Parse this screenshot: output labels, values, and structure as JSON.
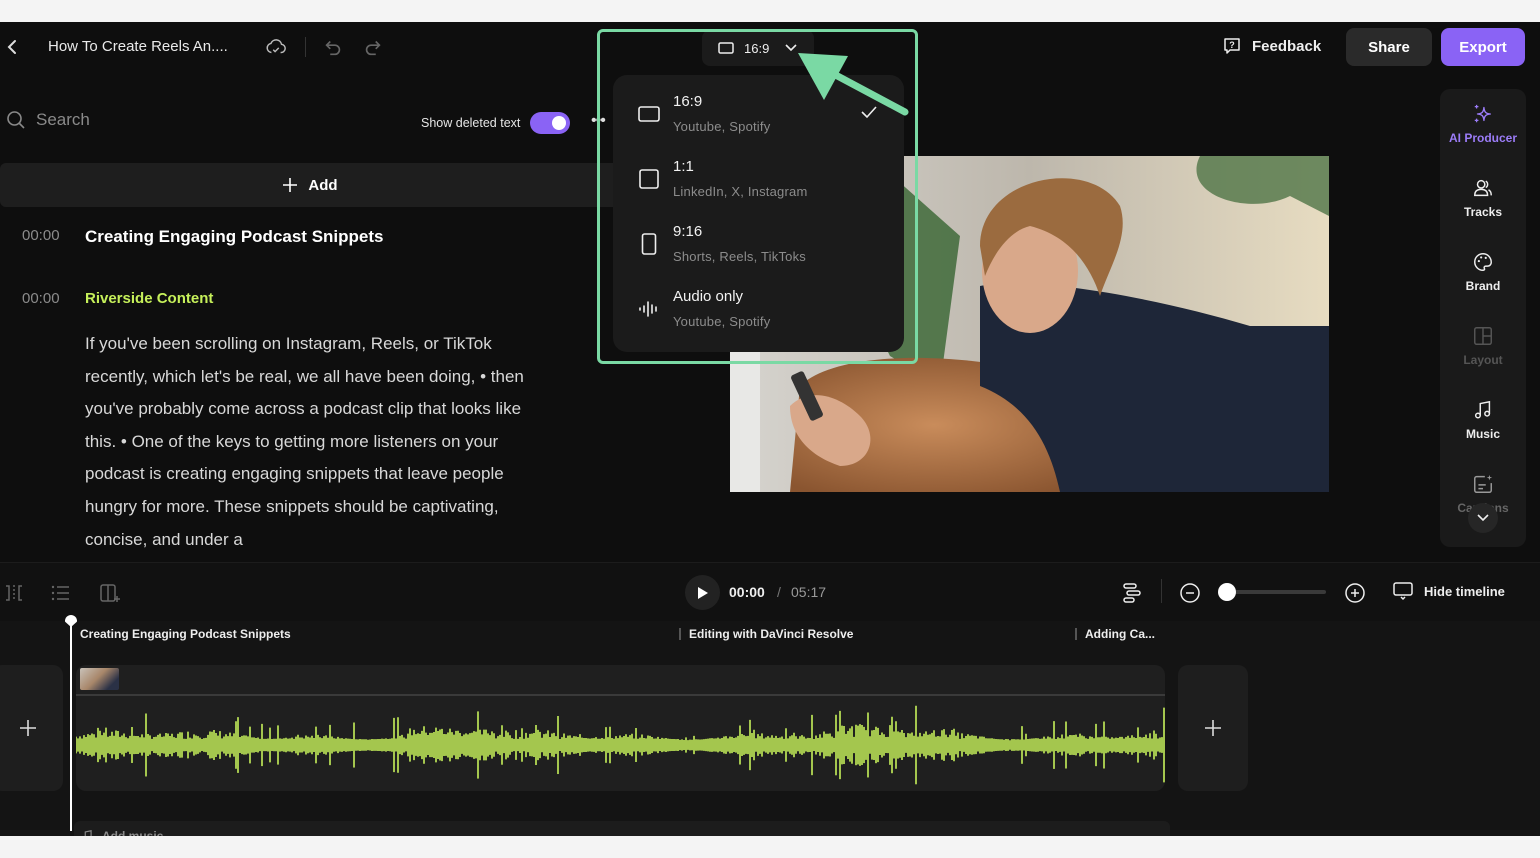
{
  "header": {
    "project_title": "How To Create Reels An....",
    "aspect_selected": "16:9",
    "feedback_label": "Feedback",
    "share_label": "Share",
    "export_label": "Export"
  },
  "transcript": {
    "search_placeholder": "Search",
    "show_deleted_label": "Show deleted text",
    "show_deleted_on": true,
    "add_label": "Add",
    "entries": [
      {
        "time": "00:00",
        "text": "Creating Engaging Podcast Snippets",
        "kind": "heading"
      },
      {
        "time": "00:00",
        "text": "Riverside Content",
        "kind": "speaker"
      }
    ],
    "paragraph": "If you've been scrolling on Instagram, Reels, or TikTok recently, which let's be real, we all have been doing, • then you've probably come across a podcast clip that looks like this. • One of the keys to getting more listeners on your podcast is creating engaging snippets that leave people hungry for more. These snippets should be captivating, concise, and under a"
  },
  "aspect_menu": {
    "options": [
      {
        "label": "16:9",
        "sub": "Youtube, Spotify",
        "icon": "landscape-frame-icon",
        "selected": true
      },
      {
        "label": "1:1",
        "sub": "LinkedIn, X, Instagram",
        "icon": "square-frame-icon",
        "selected": false
      },
      {
        "label": "9:16",
        "sub": "Shorts, Reels, TikToks",
        "icon": "portrait-frame-icon",
        "selected": false
      },
      {
        "label": "Audio only",
        "sub": "Youtube, Spotify",
        "icon": "audio-wave-icon",
        "selected": false
      }
    ]
  },
  "rail": {
    "items": [
      {
        "label": "AI Producer",
        "icon": "sparkles-icon",
        "state": "active"
      },
      {
        "label": "Tracks",
        "icon": "users-icon",
        "state": "normal"
      },
      {
        "label": "Brand",
        "icon": "palette-icon",
        "state": "normal"
      },
      {
        "label": "Layout",
        "icon": "layout-icon",
        "state": "disabled"
      },
      {
        "label": "Music",
        "icon": "music-icon",
        "state": "normal"
      },
      {
        "label": "Captions",
        "icon": "captions-icon",
        "state": "normal"
      }
    ]
  },
  "timeline": {
    "current_time": "00:00",
    "separator": "/",
    "total_time": "05:17",
    "zoom_level": 0.0,
    "hide_timeline_label": "Hide timeline",
    "chapters": [
      "Creating Engaging Podcast Snippets",
      "Editing with DaVinci Resolve",
      "Adding Ca..."
    ],
    "add_music_label": "Add music"
  },
  "colors": {
    "accent": "#8a63f5",
    "highlight": "#7ad9a4",
    "waveform": "#c6f05a",
    "speaker": "#c6f05a"
  }
}
